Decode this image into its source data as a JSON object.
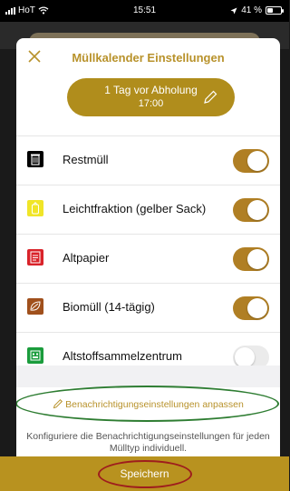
{
  "status_bar": {
    "carrier": "HoT",
    "time": "15:51",
    "battery": "41 %",
    "battery_level": 0.41
  },
  "header": {
    "title": "Müllkalender Einstellungen",
    "close_icon": "close-icon"
  },
  "reminder": {
    "line1": "1 Tag vor Abholung",
    "line2": "17:00",
    "edit_icon": "pencil-icon"
  },
  "waste_types": [
    {
      "label": "Restmüll",
      "enabled": true,
      "icon": "trash-can-icon",
      "color": "#000000"
    },
    {
      "label": "Leichtfraktion (gelber Sack)",
      "enabled": true,
      "icon": "yellow-bag-icon",
      "color": "#f0e528"
    },
    {
      "label": "Altpapier",
      "enabled": true,
      "icon": "paper-icon",
      "color": "#d9232a"
    },
    {
      "label": "Biomüll (14-tägig)",
      "enabled": true,
      "icon": "bio-waste-icon",
      "color": "#a0501c"
    },
    {
      "label": "Altstoffsammelzentrum",
      "enabled": false,
      "icon": "recycling-center-icon",
      "color": "#1a9c3c"
    }
  ],
  "notifications_link": "Benachrichtigungseinstellungen anpassen",
  "description": "Konfiguriere die Benachrichtigungseinstellungen für jeden Mülltyp individuell.",
  "save_label": "Speichern",
  "colors": {
    "accent": "#b8922b",
    "toggle_on": "#b07f24",
    "annotation_green": "#2e7d32",
    "annotation_red": "#9e1d1d"
  }
}
